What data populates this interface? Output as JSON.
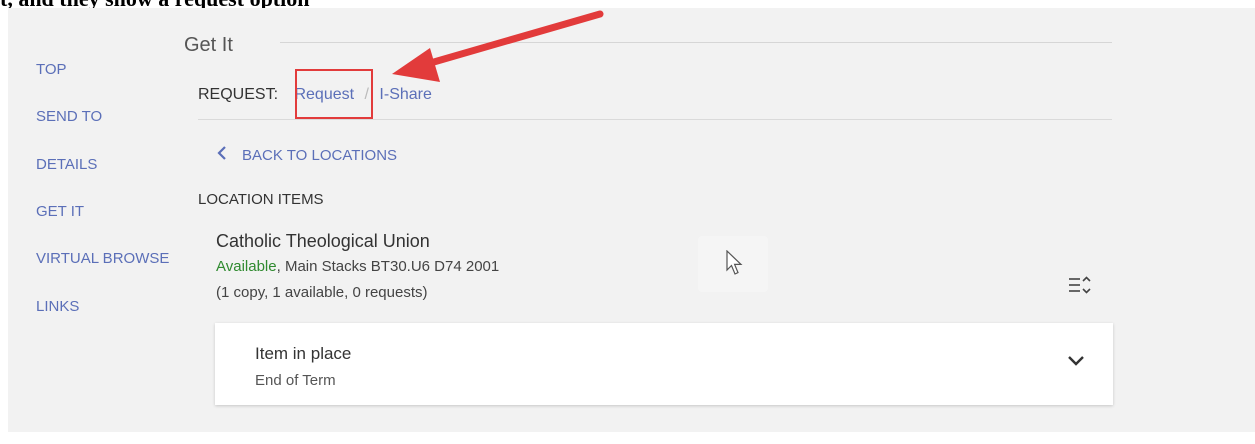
{
  "header_cut": "t, and they show a request option",
  "sidebar": {
    "items": [
      {
        "label": "TOP"
      },
      {
        "label": "SEND TO"
      },
      {
        "label": "DETAILS"
      },
      {
        "label": "GET IT"
      },
      {
        "label": "VIRTUAL BROWSE"
      },
      {
        "label": "LINKS"
      }
    ]
  },
  "getit": {
    "title": "Get It",
    "request_label": "REQUEST:",
    "request_link": "Request",
    "separator": "/",
    "ishare_link": "I-Share",
    "back_link": "BACK TO LOCATIONS",
    "location_items_title": "LOCATION ITEMS",
    "location": {
      "name": "Catholic Theological Union",
      "availability": "Available",
      "call_number": ", Main Stacks BT30.U6 D74 2001",
      "copies": "(1 copy, 1 available, 0 requests)"
    },
    "item": {
      "status": "Item in place",
      "policy": "End of Term"
    }
  },
  "colors": {
    "link": "#5b6fb8",
    "available": "#2f8a2f",
    "annotation": "#e23b3b",
    "panel_bg": "#f2f2f2"
  },
  "icons": {
    "back": "chevron-left-icon",
    "sort": "list-sort-icon",
    "expand": "chevron-down-icon",
    "annotation": "red-arrow-icon",
    "cursor": "mouse-pointer-icon"
  }
}
